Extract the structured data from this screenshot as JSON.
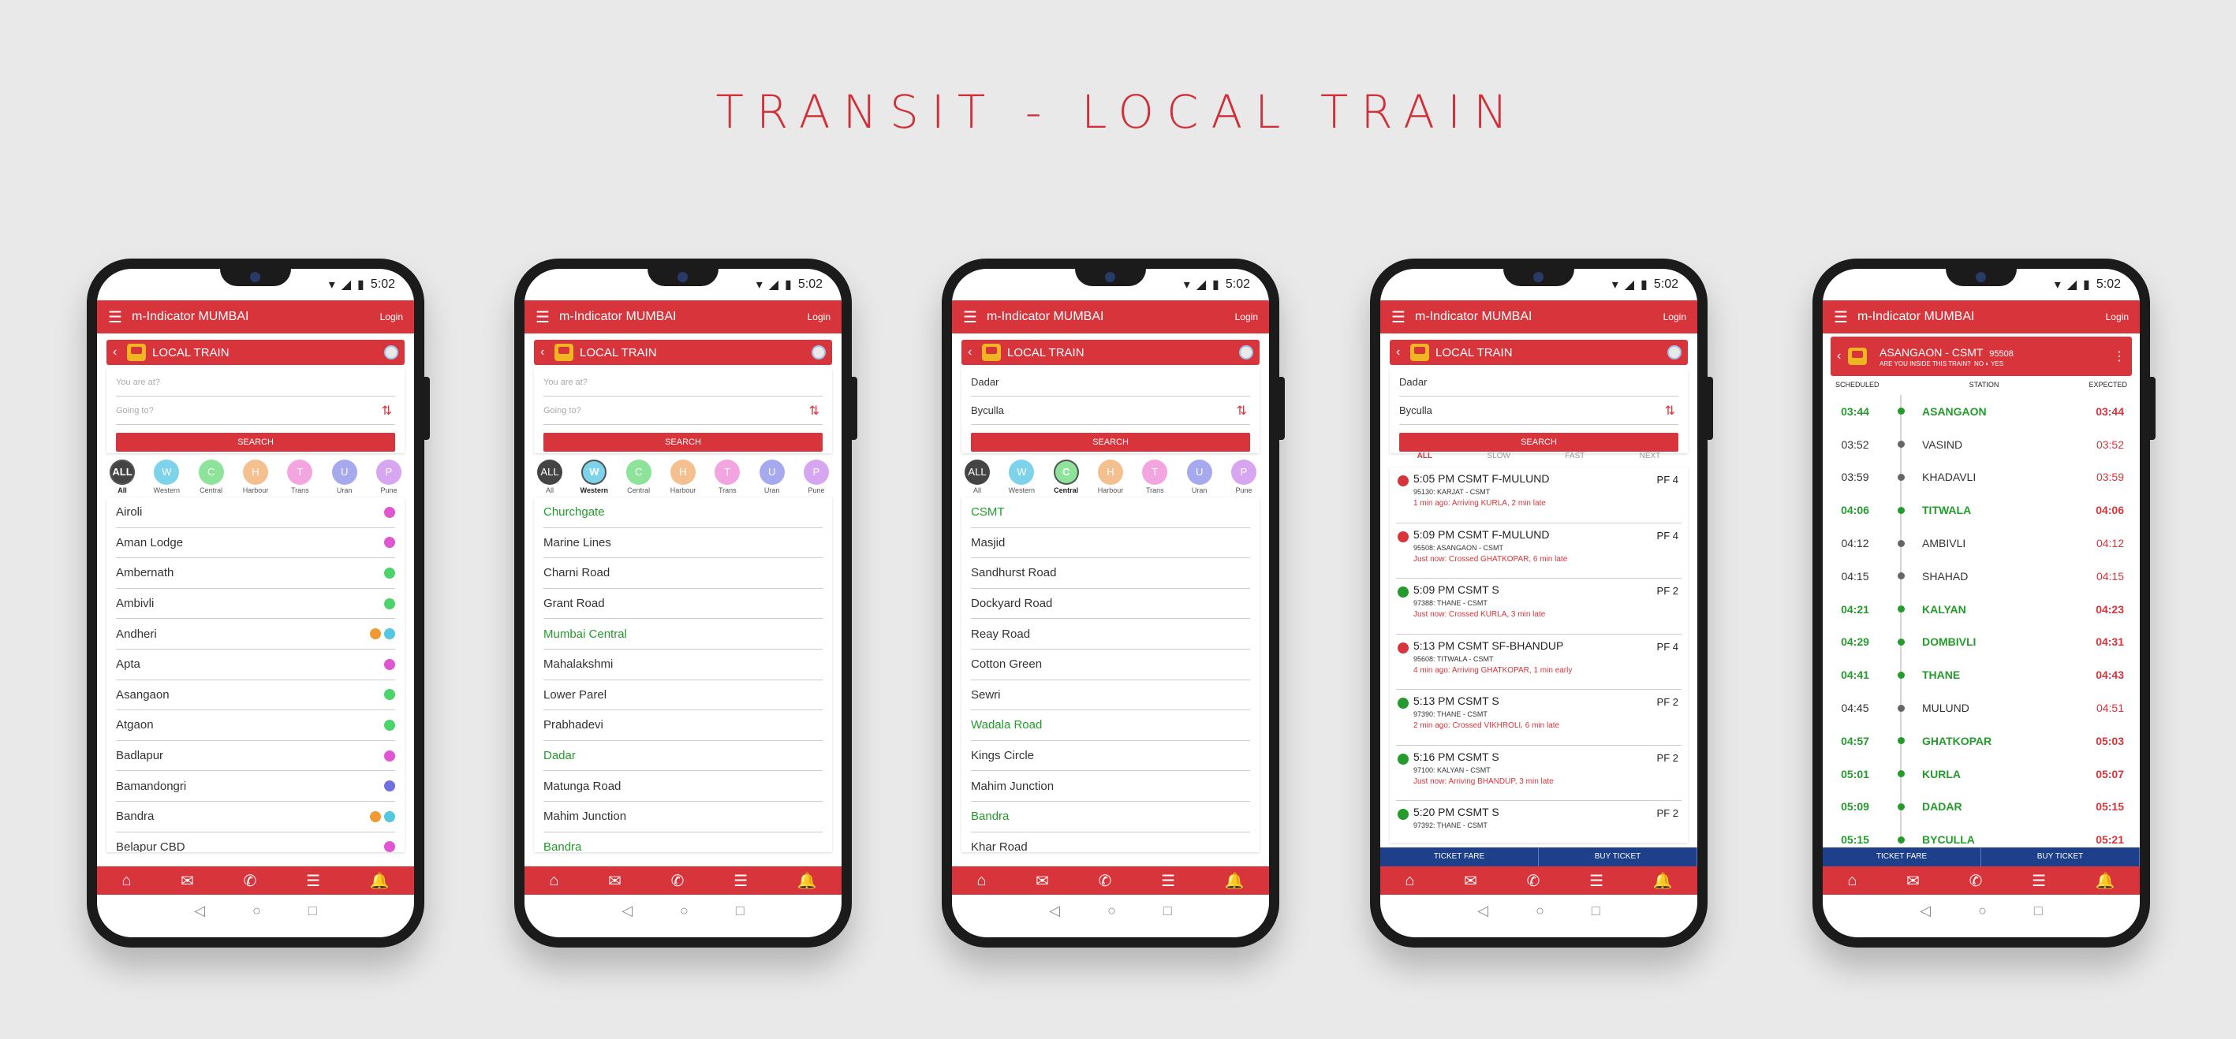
{
  "page_title": "TRANSIT - LOCAL TRAIN",
  "status_time": "5:02",
  "app_title": "m-Indicator MUMBAI",
  "login": "Login",
  "local_train_label": "LOCAL TRAIN",
  "search_label": "SEARCH",
  "placeholders": {
    "from": "You are at?",
    "to": "Going to?"
  },
  "chips": [
    {
      "code": "ALL",
      "name": "All",
      "color": "#444444"
    },
    {
      "code": "W",
      "name": "Western",
      "color": "#7dd3ea"
    },
    {
      "code": "C",
      "name": "Central",
      "color": "#8ee39a"
    },
    {
      "code": "H",
      "name": "Harbour",
      "color": "#f5c08f"
    },
    {
      "code": "T",
      "name": "Trans",
      "color": "#f3a5e0"
    },
    {
      "code": "U",
      "name": "Uran",
      "color": "#a7a9ef"
    },
    {
      "code": "P",
      "name": "Pune",
      "color": "#d7a6f0"
    }
  ],
  "screen1": {
    "stations": [
      {
        "name": "Airoli",
        "dots": [
          "#e055d0"
        ]
      },
      {
        "name": "Aman Lodge",
        "dots": [
          "#e055d0"
        ]
      },
      {
        "name": "Ambernath",
        "dots": [
          "#4bd46a"
        ]
      },
      {
        "name": "Ambivli",
        "dots": [
          "#4bd46a"
        ]
      },
      {
        "name": "Andheri",
        "dots": [
          "#f19a35",
          "#52c8e2"
        ]
      },
      {
        "name": "Apta",
        "dots": [
          "#e055d0"
        ]
      },
      {
        "name": "Asangaon",
        "dots": [
          "#4bd46a"
        ]
      },
      {
        "name": "Atgaon",
        "dots": [
          "#4bd46a"
        ]
      },
      {
        "name": "Badlapur",
        "dots": [
          "#e055d0"
        ]
      },
      {
        "name": "Bamandongri",
        "dots": [
          "#6f6fe0"
        ]
      },
      {
        "name": "Bandra",
        "dots": [
          "#f19a35",
          "#52c8e2"
        ]
      },
      {
        "name": "Belapur CBD",
        "dots": [
          "#e055d0"
        ]
      }
    ]
  },
  "screen2": {
    "stations": [
      {
        "name": "Churchgate",
        "green": true
      },
      {
        "name": "Marine Lines",
        "green": false
      },
      {
        "name": "Charni Road",
        "green": false
      },
      {
        "name": "Grant Road",
        "green": false
      },
      {
        "name": "Mumbai Central",
        "green": true
      },
      {
        "name": "Mahalakshmi",
        "green": false
      },
      {
        "name": "Lower Parel",
        "green": false
      },
      {
        "name": "Prabhadevi",
        "green": false
      },
      {
        "name": "Dadar",
        "green": true
      },
      {
        "name": "Matunga Road",
        "green": false
      },
      {
        "name": "Mahim Junction",
        "green": false
      },
      {
        "name": "Bandra",
        "green": true
      }
    ]
  },
  "screen3": {
    "from": "Dadar",
    "to": "Byculla",
    "stations": [
      {
        "name": "CSMT",
        "green": true
      },
      {
        "name": "Masjid",
        "green": false
      },
      {
        "name": "Sandhurst Road",
        "green": false
      },
      {
        "name": "Dockyard Road",
        "green": false
      },
      {
        "name": "Reay Road",
        "green": false
      },
      {
        "name": "Cotton Green",
        "green": false
      },
      {
        "name": "Sewri",
        "green": false
      },
      {
        "name": "Wadala Road",
        "green": true
      },
      {
        "name": "Kings Circle",
        "green": false
      },
      {
        "name": "Mahim Junction",
        "green": false
      },
      {
        "name": "Bandra",
        "green": true
      },
      {
        "name": "Khar Road",
        "green": false
      }
    ]
  },
  "screen4": {
    "from": "Dadar",
    "to": "Byculla",
    "tabs": [
      "ALL",
      "SLOW",
      "FAST",
      "NEXT"
    ],
    "trains": [
      {
        "title": "5:05 PM CSMT   F-MULUND",
        "pf": "PF 4",
        "route": "95130: KARJAT - CSMT",
        "status": "1 min ago: Arriving KURLA, 2 min late",
        "color": "#d8343b"
      },
      {
        "title": "5:09 PM CSMT   F-MULUND",
        "pf": "PF 4",
        "route": "95508: ASANGAON - CSMT",
        "status": "Just now: Crossed GHATKOPAR, 6 min late",
        "color": "#d8343b"
      },
      {
        "title": "5:09 PM CSMT   S",
        "pf": "PF 2",
        "route": "97388: THANE - CSMT",
        "status": "Just now: Crossed KURLA, 3 min late",
        "color": "#249b2c"
      },
      {
        "title": "5:13 PM CSMT   SF-BHANDUP",
        "pf": "PF 4",
        "route": "95608: TITWALA - CSMT",
        "status": "4 min ago: Arriving GHATKOPAR, 1 min early",
        "color": "#d8343b"
      },
      {
        "title": "5:13 PM CSMT   S",
        "pf": "PF 2",
        "route": "97390: THANE - CSMT",
        "status": "2 min ago: Crossed VIKHROLI, 6 min late",
        "color": "#249b2c"
      },
      {
        "title": "5:16 PM CSMT   S",
        "pf": "PF 2",
        "route": "97100: KALYAN - CSMT",
        "status": "Just now: Arriving BHANDUP, 3 min late",
        "color": "#249b2c"
      },
      {
        "title": "5:20 PM CSMT   S",
        "pf": "PF 2",
        "route": "97392: THANE - CSMT",
        "status": "",
        "color": "#249b2c"
      }
    ],
    "fare": [
      "TICKET FARE",
      "BUY TICKET"
    ]
  },
  "screen5": {
    "route": "ASANGAON - CSMT",
    "train_no": "95508",
    "inside": "ARE YOU INSIDE THIS TRAIN?",
    "no": "NO",
    "yes": "YES",
    "cols": [
      "SCHEDULED",
      "STATION",
      "EXPECTED"
    ],
    "stops": [
      {
        "s": "03:44",
        "st": "ASANGAON",
        "e": "03:44",
        "g": true
      },
      {
        "s": "03:52",
        "st": "VASIND",
        "e": "03:52",
        "g": false
      },
      {
        "s": "03:59",
        "st": "KHADAVLI",
        "e": "03:59",
        "g": false
      },
      {
        "s": "04:06",
        "st": "TITWALA",
        "e": "04:06",
        "g": true
      },
      {
        "s": "04:12",
        "st": "AMBIVLI",
        "e": "04:12",
        "g": false
      },
      {
        "s": "04:15",
        "st": "SHAHAD",
        "e": "04:15",
        "g": false
      },
      {
        "s": "04:21",
        "st": "KALYAN",
        "e": "04:23",
        "g": true
      },
      {
        "s": "04:29",
        "st": "DOMBIVLI",
        "e": "04:31",
        "g": true
      },
      {
        "s": "04:41",
        "st": "THANE",
        "e": "04:43",
        "g": true
      },
      {
        "s": "04:45",
        "st": "MULUND",
        "e": "04:51",
        "g": false
      },
      {
        "s": "04:57",
        "st": "GHATKOPAR",
        "e": "05:03",
        "g": true
      },
      {
        "s": "05:01",
        "st": "KURLA",
        "e": "05:07",
        "g": true
      },
      {
        "s": "05:09",
        "st": "DADAR",
        "e": "05:15",
        "g": true
      },
      {
        "s": "05:15",
        "st": "BYCULLA",
        "e": "05:21",
        "g": true
      }
    ],
    "fare": [
      "TICKET FARE",
      "BUY TICKET"
    ]
  },
  "nav_icons": [
    "home-icon",
    "chat-icon",
    "phone-icon",
    "document-icon",
    "bell-icon"
  ]
}
